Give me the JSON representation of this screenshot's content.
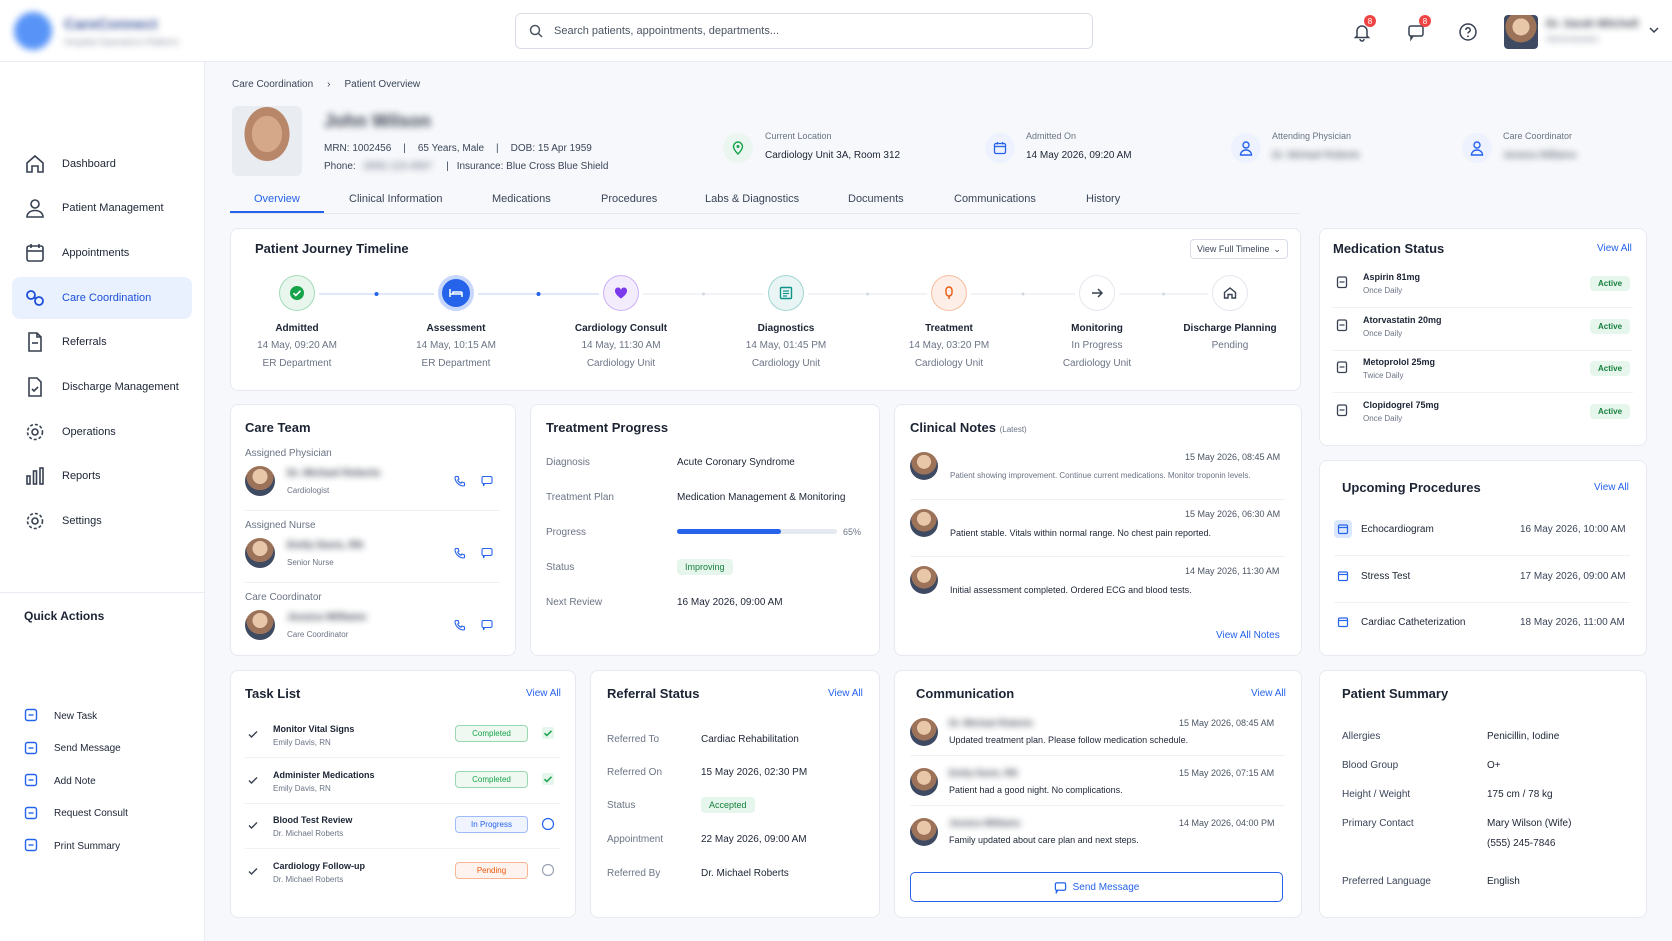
{
  "header": {
    "brand_name": "CareConnect",
    "brand_tagline": "Hospital Operations Platform",
    "search_placeholder": "Search patients, appointments, departments...",
    "notif_count": "8",
    "message_count": "8",
    "user_name": "Dr. Sarah Mitchell",
    "user_role": "Administrator"
  },
  "sidebar": {
    "items": [
      {
        "label": "Dashboard",
        "icon": "home-icon"
      },
      {
        "label": "Patient Management",
        "icon": "user-icon"
      },
      {
        "label": "Appointments",
        "icon": "calendar-icon"
      },
      {
        "label": "Care Coordination",
        "icon": "link-icon",
        "active": true
      },
      {
        "label": "Referrals",
        "icon": "file-icon"
      },
      {
        "label": "Discharge Management",
        "icon": "file-check-icon"
      },
      {
        "label": "Operations",
        "icon": "gear-icon"
      },
      {
        "label": "Reports",
        "icon": "bar-chart-icon"
      },
      {
        "label": "Settings",
        "icon": "settings-icon"
      }
    ],
    "quick_actions_title": "Quick Actions",
    "quick_actions": [
      "New Task",
      "Send Message",
      "Add Note",
      "Request Consult",
      "Print Summary"
    ]
  },
  "breadcrumb": {
    "parent": "Care Coordination",
    "current": "Patient Overview"
  },
  "patient": {
    "name": "John Wilson",
    "mrn": "MRN: 1002456",
    "age_sex": "65 Years, Male",
    "dob": "DOB: 15 Apr 1959",
    "phone_label": "Phone:",
    "phone": "(555) 123-4567",
    "insurance": "Insurance: Blue Cross Blue Shield",
    "location_label": "Current Location",
    "location": "Cardiology Unit 3A, Room 312",
    "admitted_label": "Admitted On",
    "admitted": "14 May 2026, 09:20 AM",
    "physician_label": "Attending Physician",
    "physician": "Dr. Michael Roberts",
    "coordinator_label": "Care Coordinator",
    "coordinator": "Jessica Williams"
  },
  "tabs": [
    "Overview",
    "Clinical Information",
    "Medications",
    "Procedures",
    "Labs & Diagnostics",
    "Documents",
    "Communications",
    "History"
  ],
  "timeline": {
    "title": "Patient Journey Timeline",
    "button": "View Full Timeline",
    "steps": [
      {
        "name": "Admitted",
        "date": "14 May, 09:20 AM",
        "place": "ER Department",
        "icon": "check-icon",
        "color": "#16a34a",
        "state": "done"
      },
      {
        "name": "Assessment",
        "date": "14 May, 10:15 AM",
        "place": "ER Department",
        "icon": "bed-icon",
        "color": "#2563eb",
        "state": "current"
      },
      {
        "name": "Cardiology Consult",
        "date": "14 May, 11:30 AM",
        "place": "Cardiology Unit",
        "icon": "heart-icon",
        "color": "#7c3aed",
        "state": "done"
      },
      {
        "name": "Diagnostics",
        "date": "14 May, 01:45 PM",
        "place": "Cardiology Unit",
        "icon": "monitor-icon",
        "color": "#0d9488",
        "state": "done"
      },
      {
        "name": "Treatment",
        "date": "14 May, 03:20 PM",
        "place": "Cardiology Unit",
        "icon": "pill-icon",
        "color": "#ea580c",
        "state": "done"
      },
      {
        "name": "Monitoring",
        "date": "In Progress",
        "place": "Cardiology Unit",
        "icon": "arrow-right-icon",
        "color": "#374151",
        "state": "pending"
      },
      {
        "name": "Discharge Planning",
        "date": "Pending",
        "place": "",
        "icon": "home-icon",
        "color": "#374151",
        "state": "pending"
      }
    ]
  },
  "medication_status": {
    "title": "Medication Status",
    "view_all": "View All",
    "items": [
      {
        "name": "Aspirin 81mg",
        "freq": "Once Daily",
        "status": "Active"
      },
      {
        "name": "Atorvastatin 20mg",
        "freq": "Once Daily",
        "status": "Active"
      },
      {
        "name": "Metoprolol 25mg",
        "freq": "Twice Daily",
        "status": "Active"
      },
      {
        "name": "Clopidogrel 75mg",
        "freq": "Once Daily",
        "status": "Active"
      }
    ]
  },
  "care_team": {
    "title": "Care Team",
    "members": [
      {
        "section": "Assigned Physician",
        "name": "Dr. Michael Roberts",
        "role": "Cardiologist"
      },
      {
        "section": "Assigned Nurse",
        "name": "Emily Davis, RN",
        "role": "Senior Nurse"
      },
      {
        "section": "Care Coordinator",
        "name": "Jessica Williams",
        "role": "Care Coordinator"
      }
    ]
  },
  "treatment": {
    "title": "Treatment Progress",
    "diagnosis_label": "Diagnosis",
    "diagnosis": "Acute Coronary Syndrome",
    "plan_label": "Treatment Plan",
    "plan": "Medication Management & Monitoring",
    "progress_label": "Progress",
    "progress_text": "65%",
    "progress_value": 0.65,
    "status_label": "Status",
    "status": "Improving",
    "review_label": "Next Review",
    "review": "16 May 2026, 09:00 AM"
  },
  "clinical_notes": {
    "title": "Clinical Notes",
    "title_suffix": "(Latest)",
    "view_all": "View All Notes",
    "items": [
      {
        "time": "15 May 2026, 08:45 AM",
        "text": "Patient showing improvement. Continue current medications. Monitor troponin levels."
      },
      {
        "time": "15 May 2026, 06:30 AM",
        "text": "Patient stable. Vitals within normal range. No chest pain reported."
      },
      {
        "time": "14 May 2026, 11:30 AM",
        "text": "Initial assessment completed. Ordered ECG and blood tests."
      }
    ]
  },
  "upcoming": {
    "title": "Upcoming Procedures",
    "view_all": "View All",
    "items": [
      {
        "name": "Echocardiogram",
        "time": "16 May 2026, 10:00 AM"
      },
      {
        "name": "Stress Test",
        "time": "17 May 2026, 09:00 AM"
      },
      {
        "name": "Cardiac Catheterization",
        "time": "18 May 2026, 11:00 AM"
      }
    ]
  },
  "tasks": {
    "title": "Task List",
    "view_all": "View All",
    "items": [
      {
        "name": "Monitor Vital Signs",
        "who": "Emily Davis, RN",
        "status": "Completed",
        "color": "#16a34a"
      },
      {
        "name": "Administer Medications",
        "who": "Emily Davis, RN",
        "status": "Completed",
        "color": "#16a34a"
      },
      {
        "name": "Blood Test Review",
        "who": "Dr. Michael Roberts",
        "status": "In Progress",
        "color": "#2563eb"
      },
      {
        "name": "Cardiology Follow-up",
        "who": "Dr. Michael Roberts",
        "status": "Pending",
        "color": "#ea580c"
      }
    ]
  },
  "referral": {
    "title": "Referral Status",
    "view_all": "View All",
    "to_label": "Referred To",
    "to": "Cardiac Rehabilitation",
    "on_label": "Referred On",
    "on": "15 May 2026, 02:30 PM",
    "status_label": "Status",
    "status": "Accepted",
    "appt_label": "Appointment",
    "appt": "22 May 2026, 09:00 AM",
    "by_label": "Referred By",
    "by": "Dr. Michael Roberts"
  },
  "communication": {
    "title": "Communication",
    "view_all": "View All",
    "button": "Send Message",
    "items": [
      {
        "who": "Dr. Michael Roberts",
        "time": "15 May 2026, 08:45 AM",
        "text": "Updated treatment plan. Please follow medication schedule."
      },
      {
        "who": "Emily Davis, RN",
        "time": "15 May 2026, 07:15 AM",
        "text": "Patient had a good night. No complications."
      },
      {
        "who": "Jessica Williams",
        "time": "14 May 2026, 04:00 PM",
        "text": "Family updated about care plan and next steps."
      }
    ]
  },
  "summary": {
    "title": "Patient Summary",
    "rows": [
      {
        "label": "Allergies",
        "value": "Penicillin, Iodine",
        "value2": ""
      },
      {
        "label": "Blood Group",
        "value": "O+",
        "value2": ""
      },
      {
        "label": "Height / Weight",
        "value": "175 cm / 78 kg",
        "value2": ""
      },
      {
        "label": "Primary Contact",
        "value": "Mary Wilson (Wife)",
        "value2": "(555) 245-7846"
      },
      {
        "label": "Preferred Language",
        "value": "English",
        "value2": ""
      }
    ]
  }
}
